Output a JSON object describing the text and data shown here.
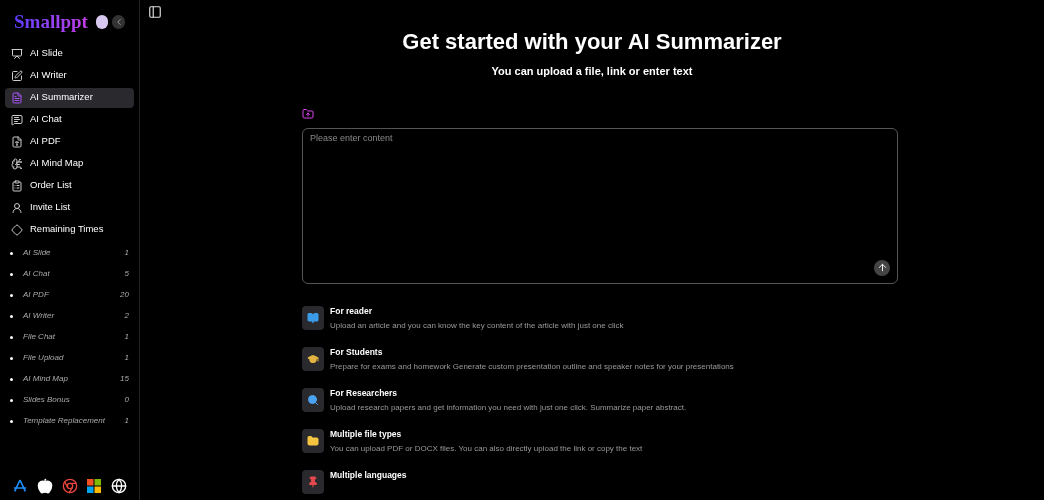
{
  "brand": "Smallppt",
  "nav": [
    {
      "label": "AI Slide",
      "selected": false
    },
    {
      "label": "AI Writer",
      "selected": false
    },
    {
      "label": "AI Summarizer",
      "selected": true
    },
    {
      "label": "AI Chat",
      "selected": false
    },
    {
      "label": "AI PDF",
      "selected": false
    },
    {
      "label": "AI Mind Map",
      "selected": false
    },
    {
      "label": "Order List",
      "selected": false
    },
    {
      "label": "Invite List",
      "selected": false
    },
    {
      "label": "Remaining Times",
      "selected": false
    }
  ],
  "remaining": [
    {
      "label": "AI Slide",
      "count": "1"
    },
    {
      "label": "AI Chat",
      "count": "5"
    },
    {
      "label": "AI PDF",
      "count": "20"
    },
    {
      "label": "AI Writer",
      "count": "2"
    },
    {
      "label": "File Chat",
      "count": "1"
    },
    {
      "label": "File Upload",
      "count": "1"
    },
    {
      "label": "AI Mind Map",
      "count": "15"
    },
    {
      "label": "Slides Bonus",
      "count": "0"
    },
    {
      "label": "Template Replacement",
      "count": "1"
    }
  ],
  "title": "Get started with your AI Summarizer",
  "subtitle": "You can upload a file, link or enter text",
  "input": {
    "placeholder": "Please enter content"
  },
  "features": [
    {
      "title": "For reader",
      "description": "Upload an article and you can know the key content of the article with just one click"
    },
    {
      "title": "For Students",
      "description": "Prepare for exams and homework Generate custom presentation outline and speaker notes for your presentations"
    },
    {
      "title": "For Researchers",
      "description": "Upload research papers and get information you need with just one click. Summarize paper abstract."
    },
    {
      "title": "Multiple file types",
      "description": "You can upload PDF or DOCX files. You can also directly upload the link or copy the text"
    },
    {
      "title": "Multiple languages"
    }
  ]
}
